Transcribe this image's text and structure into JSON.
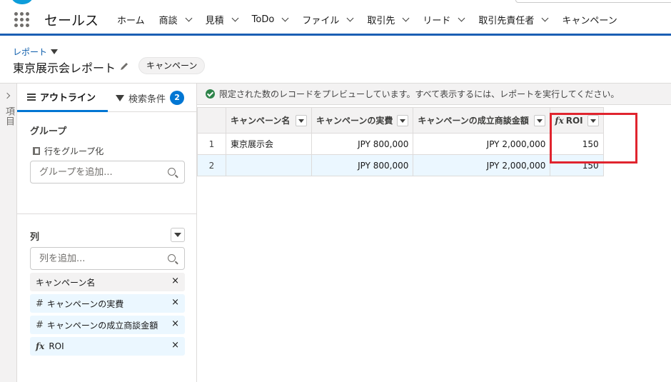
{
  "app": {
    "name": "セールス",
    "nav": [
      {
        "label": "ホーム",
        "has_menu": false
      },
      {
        "label": "商談",
        "has_menu": true
      },
      {
        "label": "見積",
        "has_menu": true
      },
      {
        "label": "ToDo",
        "has_menu": true
      },
      {
        "label": "ファイル",
        "has_menu": true
      },
      {
        "label": "取引先",
        "has_menu": true
      },
      {
        "label": "リード",
        "has_menu": true
      },
      {
        "label": "取引先責任者",
        "has_menu": true
      },
      {
        "label": "キャンペーン",
        "has_menu": false
      }
    ]
  },
  "header": {
    "breadcrumb": "レポート",
    "title": "東京展示会レポート",
    "report_type": "キャンペーン"
  },
  "rail": {
    "label": "項目"
  },
  "panel": {
    "tab_outline": "アウトライン",
    "tab_filters": "検索条件",
    "filter_count": "2",
    "groups": {
      "title": "グループ",
      "row_group_label": "行をグループ化",
      "search_placeholder": "グループを追加..."
    },
    "columns": {
      "title": "列",
      "search_placeholder": "列を追加...",
      "items": [
        {
          "label": "キャンペーン名",
          "prefix": ""
        },
        {
          "label": "キャンペーンの実費",
          "prefix": "#"
        },
        {
          "label": "キャンペーンの成立商談金額",
          "prefix": "#"
        },
        {
          "label": "ROI",
          "prefix": "fx"
        }
      ],
      "remove_glyph": "×"
    }
  },
  "preview": {
    "notice": "限定された数のレコードをプレビューしています。すべて表示するには、レポートを実行してください。",
    "headers": [
      "キャンペーン名",
      "キャンペーンの実費",
      "キャンペーンの成立商談金額",
      "ROI"
    ],
    "rows": [
      {
        "num": "1",
        "name": "東京展示会",
        "cost": "JPY 800,000",
        "won": "JPY 2,000,000",
        "roi": "150"
      },
      {
        "num": "2",
        "name": "",
        "cost": "JPY 800,000",
        "won": "JPY 2,000,000",
        "roi": "150"
      }
    ]
  },
  "colors": {
    "brand_blue": "#0176d3",
    "nav_underline": "#1b5fb4",
    "highlight": "#e0242e"
  }
}
